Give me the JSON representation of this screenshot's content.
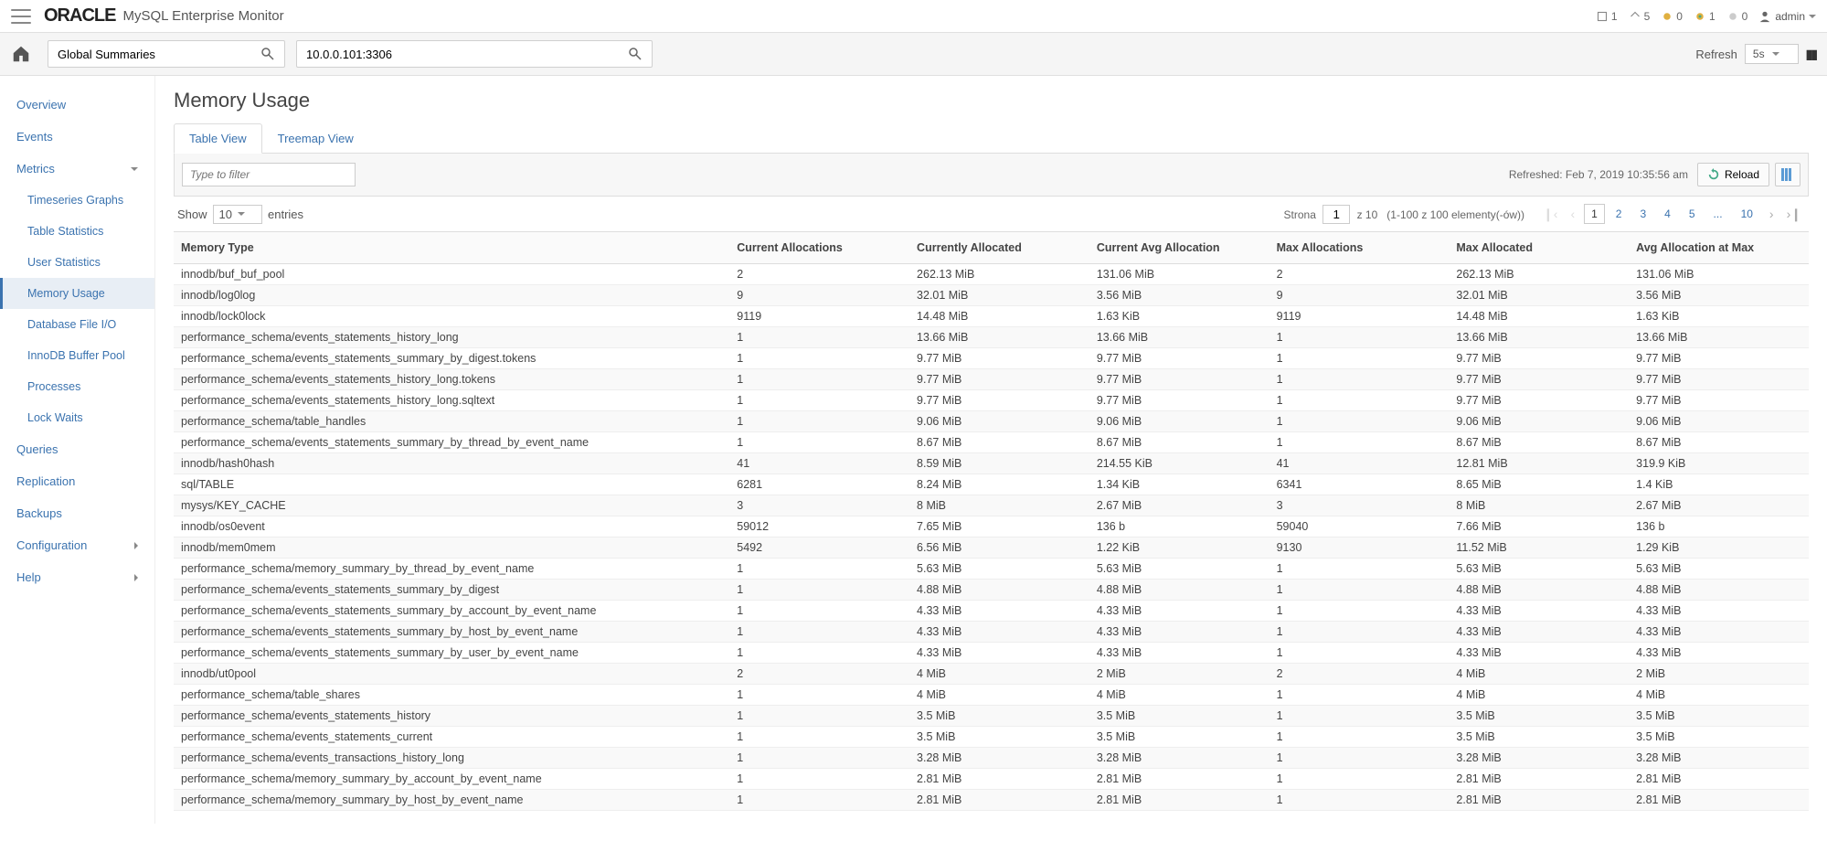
{
  "app": {
    "brand": "ORACLE",
    "title": "MySQL Enterprise Monitor"
  },
  "status": {
    "s1": "1",
    "s2": "5",
    "s3": "0",
    "s4": "1",
    "s5": "0",
    "user": "admin"
  },
  "search": {
    "context_value": "Global Summaries",
    "host_value": "10.0.0.101:3306"
  },
  "refresh": {
    "label": "Refresh",
    "interval": "5s"
  },
  "sidebar": {
    "overview": "Overview",
    "events": "Events",
    "metrics": "Metrics",
    "timeseries": "Timeseries Graphs",
    "table_stats": "Table Statistics",
    "user_stats": "User Statistics",
    "memory_usage": "Memory Usage",
    "file_io": "Database File I/O",
    "innodb_bp": "InnoDB Buffer Pool",
    "processes": "Processes",
    "lock_waits": "Lock Waits",
    "queries": "Queries",
    "replication": "Replication",
    "backups": "Backups",
    "configuration": "Configuration",
    "help": "Help"
  },
  "page": {
    "title": "Memory Usage",
    "tabs": {
      "table_view": "Table View",
      "treemap_view": "Treemap View"
    },
    "filter_placeholder": "Type to filter",
    "refreshed": "Refreshed: Feb 7, 2019 10:35:56 am",
    "reload": "Reload",
    "show_label": "Show",
    "show_value": "10",
    "entries_label": "entries",
    "strona_label": "Strona",
    "page_input": "1",
    "z_label": "z 10",
    "range_label": "(1-100 z 100 elementy(-ów))",
    "page_links": [
      "1",
      "2",
      "3",
      "4",
      "5",
      "...",
      "10"
    ]
  },
  "columns": [
    "Memory Type",
    "Current Allocations",
    "Currently Allocated",
    "Current Avg Allocation",
    "Max Allocations",
    "Max Allocated",
    "Avg Allocation at Max"
  ],
  "rows": [
    [
      "innodb/buf_buf_pool",
      "2",
      "262.13 MiB",
      "131.06 MiB",
      "2",
      "262.13 MiB",
      "131.06 MiB"
    ],
    [
      "innodb/log0log",
      "9",
      "32.01 MiB",
      "3.56 MiB",
      "9",
      "32.01 MiB",
      "3.56 MiB"
    ],
    [
      "innodb/lock0lock",
      "9119",
      "14.48 MiB",
      "1.63 KiB",
      "9119",
      "14.48 MiB",
      "1.63 KiB"
    ],
    [
      "performance_schema/events_statements_history_long",
      "1",
      "13.66 MiB",
      "13.66 MiB",
      "1",
      "13.66 MiB",
      "13.66 MiB"
    ],
    [
      "performance_schema/events_statements_summary_by_digest.tokens",
      "1",
      "9.77 MiB",
      "9.77 MiB",
      "1",
      "9.77 MiB",
      "9.77 MiB"
    ],
    [
      "performance_schema/events_statements_history_long.tokens",
      "1",
      "9.77 MiB",
      "9.77 MiB",
      "1",
      "9.77 MiB",
      "9.77 MiB"
    ],
    [
      "performance_schema/events_statements_history_long.sqltext",
      "1",
      "9.77 MiB",
      "9.77 MiB",
      "1",
      "9.77 MiB",
      "9.77 MiB"
    ],
    [
      "performance_schema/table_handles",
      "1",
      "9.06 MiB",
      "9.06 MiB",
      "1",
      "9.06 MiB",
      "9.06 MiB"
    ],
    [
      "performance_schema/events_statements_summary_by_thread_by_event_name",
      "1",
      "8.67 MiB",
      "8.67 MiB",
      "1",
      "8.67 MiB",
      "8.67 MiB"
    ],
    [
      "innodb/hash0hash",
      "41",
      "8.59 MiB",
      "214.55 KiB",
      "41",
      "12.81 MiB",
      "319.9 KiB"
    ],
    [
      "sql/TABLE",
      "6281",
      "8.24 MiB",
      "1.34 KiB",
      "6341",
      "8.65 MiB",
      "1.4 KiB"
    ],
    [
      "mysys/KEY_CACHE",
      "3",
      "8 MiB",
      "2.67 MiB",
      "3",
      "8 MiB",
      "2.67 MiB"
    ],
    [
      "innodb/os0event",
      "59012",
      "7.65 MiB",
      "136 b",
      "59040",
      "7.66 MiB",
      "136 b"
    ],
    [
      "innodb/mem0mem",
      "5492",
      "6.56 MiB",
      "1.22 KiB",
      "9130",
      "11.52 MiB",
      "1.29 KiB"
    ],
    [
      "performance_schema/memory_summary_by_thread_by_event_name",
      "1",
      "5.63 MiB",
      "5.63 MiB",
      "1",
      "5.63 MiB",
      "5.63 MiB"
    ],
    [
      "performance_schema/events_statements_summary_by_digest",
      "1",
      "4.88 MiB",
      "4.88 MiB",
      "1",
      "4.88 MiB",
      "4.88 MiB"
    ],
    [
      "performance_schema/events_statements_summary_by_account_by_event_name",
      "1",
      "4.33 MiB",
      "4.33 MiB",
      "1",
      "4.33 MiB",
      "4.33 MiB"
    ],
    [
      "performance_schema/events_statements_summary_by_host_by_event_name",
      "1",
      "4.33 MiB",
      "4.33 MiB",
      "1",
      "4.33 MiB",
      "4.33 MiB"
    ],
    [
      "performance_schema/events_statements_summary_by_user_by_event_name",
      "1",
      "4.33 MiB",
      "4.33 MiB",
      "1",
      "4.33 MiB",
      "4.33 MiB"
    ],
    [
      "innodb/ut0pool",
      "2",
      "4 MiB",
      "2 MiB",
      "2",
      "4 MiB",
      "2 MiB"
    ],
    [
      "performance_schema/table_shares",
      "1",
      "4 MiB",
      "4 MiB",
      "1",
      "4 MiB",
      "4 MiB"
    ],
    [
      "performance_schema/events_statements_history",
      "1",
      "3.5 MiB",
      "3.5 MiB",
      "1",
      "3.5 MiB",
      "3.5 MiB"
    ],
    [
      "performance_schema/events_statements_current",
      "1",
      "3.5 MiB",
      "3.5 MiB",
      "1",
      "3.5 MiB",
      "3.5 MiB"
    ],
    [
      "performance_schema/events_transactions_history_long",
      "1",
      "3.28 MiB",
      "3.28 MiB",
      "1",
      "3.28 MiB",
      "3.28 MiB"
    ],
    [
      "performance_schema/memory_summary_by_account_by_event_name",
      "1",
      "2.81 MiB",
      "2.81 MiB",
      "1",
      "2.81 MiB",
      "2.81 MiB"
    ],
    [
      "performance_schema/memory_summary_by_host_by_event_name",
      "1",
      "2.81 MiB",
      "2.81 MiB",
      "1",
      "2.81 MiB",
      "2.81 MiB"
    ]
  ]
}
